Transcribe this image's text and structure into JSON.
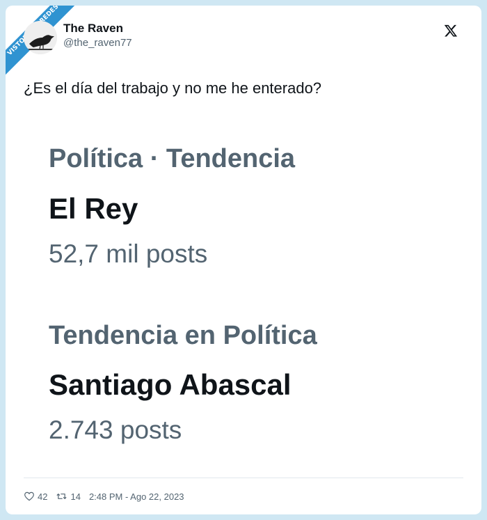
{
  "watermark": {
    "text": "VISTOENLASREDES",
    "sub": ".com"
  },
  "tweet": {
    "author_name": "The Raven",
    "author_handle": "@the_raven77",
    "text": "¿Es el día del trabajo y no me he enterado?"
  },
  "trends": [
    {
      "label": "Política · Tendencia",
      "name": "El Rey",
      "count": "52,7 mil posts"
    },
    {
      "label": "Tendencia en Política",
      "name": "Santiago Abascal",
      "count": "2.743 posts"
    }
  ],
  "footer": {
    "likes": "42",
    "retweets": "14",
    "timestamp": "2:48 PM - Ago 22, 2023"
  },
  "icons": {
    "avatar": "raven-avatar",
    "brand": "x-logo-icon",
    "like": "heart-icon",
    "retweet": "retweet-icon"
  },
  "colors": {
    "background": "#cfe7f3",
    "card": "#ffffff",
    "primary_text": "#0f1419",
    "secondary_text": "#536471",
    "ribbon": "#2f93d1"
  }
}
